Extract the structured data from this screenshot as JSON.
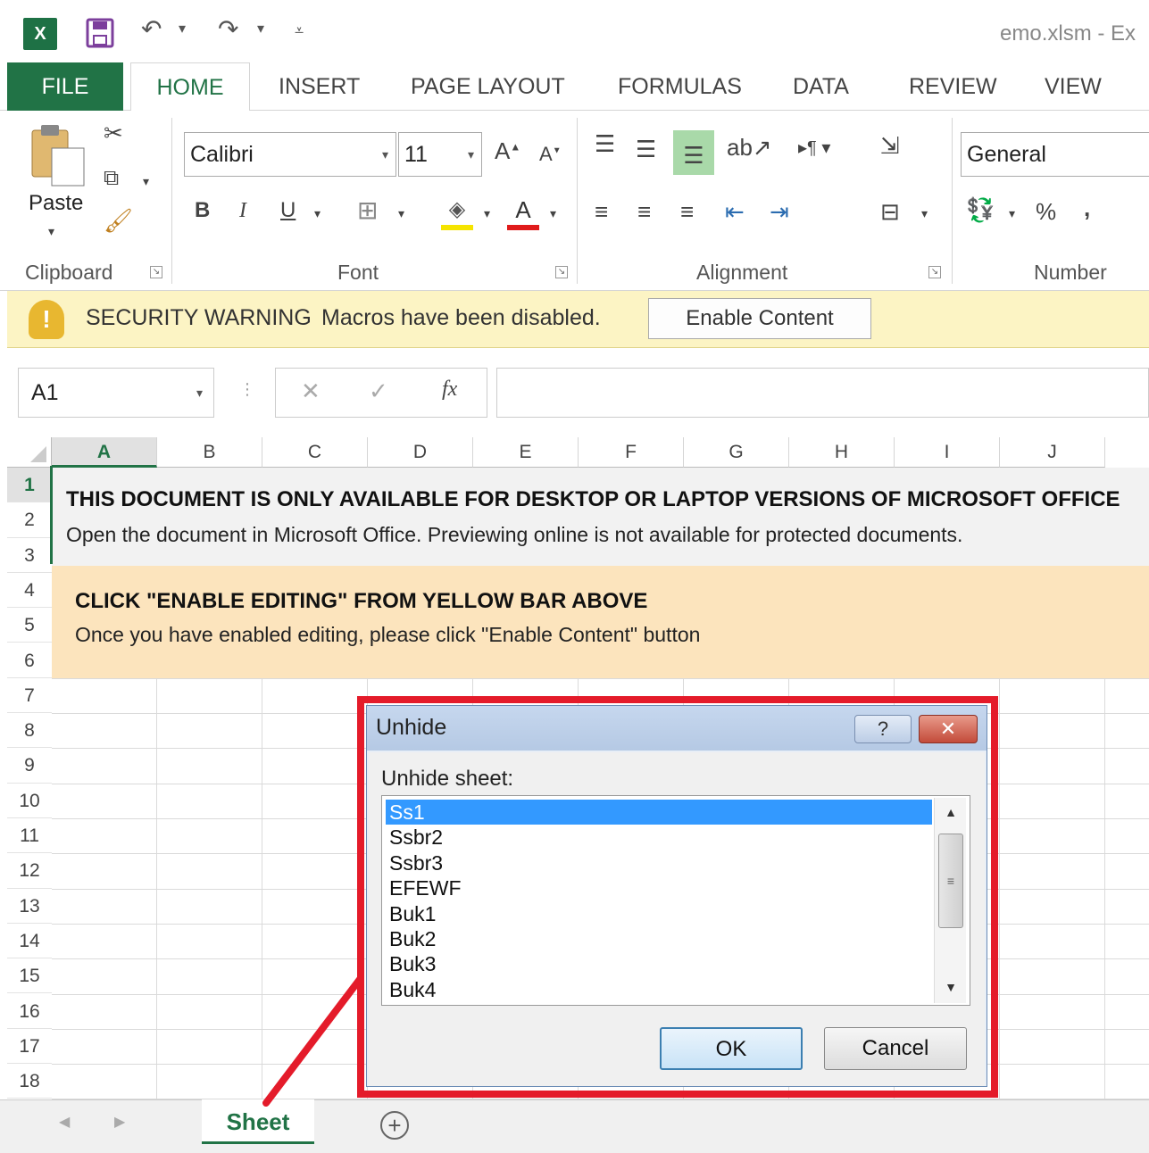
{
  "title_bar": {
    "logo_text": "X",
    "save_icon": "save-icon",
    "undo_icon": "undo-icon",
    "redo_icon": "redo-icon",
    "customize_icon": "chevron-down-icon",
    "title": "emo.xlsm - Ex"
  },
  "tabs": [
    "FILE",
    "HOME",
    "INSERT",
    "PAGE LAYOUT",
    "FORMULAS",
    "DATA",
    "REVIEW",
    "VIEW"
  ],
  "ribbon": {
    "clipboard": {
      "paste_label": "Paste",
      "group_label": "Clipboard"
    },
    "font": {
      "font_name": "Calibri",
      "font_size": "11",
      "bold": "B",
      "italic": "I",
      "underline": "U",
      "group_label": "Font",
      "highlight_color": "#f5e400",
      "font_color": "#e01b1b"
    },
    "alignment": {
      "group_label": "Alignment"
    },
    "number": {
      "format": "General",
      "percent": "%",
      "comma": ",",
      "group_label": "Number"
    }
  },
  "security_bar": {
    "title": "SECURITY WARNING",
    "message": "Macros have been disabled.",
    "button_label": "Enable Content"
  },
  "formula_bar": {
    "name_box": "A1",
    "cancel_symbol": "✕",
    "enter_symbol": "✓",
    "fx_label": "fx",
    "formula": ""
  },
  "grid": {
    "columns": [
      "A",
      "B",
      "C",
      "D",
      "E",
      "F",
      "G",
      "H",
      "I",
      "J"
    ],
    "rows": [
      "1",
      "2",
      "3",
      "4",
      "5",
      "6",
      "7",
      "8",
      "9",
      "10",
      "11",
      "12",
      "13",
      "14",
      "15",
      "16",
      "17",
      "18"
    ],
    "banner1_heading": "THIS DOCUMENT IS ONLY AVAILABLE FOR DESKTOP OR LAPTOP VERSIONS OF MICROSOFT OFFICE",
    "banner1_text": "Open the document in Microsoft Office. Previewing online is not available for protected documents.",
    "banner2_heading": "CLICK \"ENABLE EDITING\" FROM YELLOW BAR ABOVE",
    "banner2_text": "Once you have enabled editing, please click \"Enable Content\" button"
  },
  "sheet_tabs": {
    "active": "Sheet",
    "add_icon": "plus-circle-icon"
  },
  "dialog": {
    "title": "Unhide",
    "help_label": "?",
    "close_label": "✕",
    "label": "Unhide sheet:",
    "sheets": [
      "Ss1",
      "Ssbr2",
      "Ssbr3",
      "EFEWF",
      "Buk1",
      "Buk2",
      "Buk3",
      "Buk4"
    ],
    "selected_index": 0,
    "ok_label": "OK",
    "cancel_label": "Cancel"
  },
  "colors": {
    "excel_green": "#217346",
    "highlight_red": "#e41b2a",
    "warning_bar": "#fcf4c4",
    "banner_peach": "#fce4bd"
  }
}
